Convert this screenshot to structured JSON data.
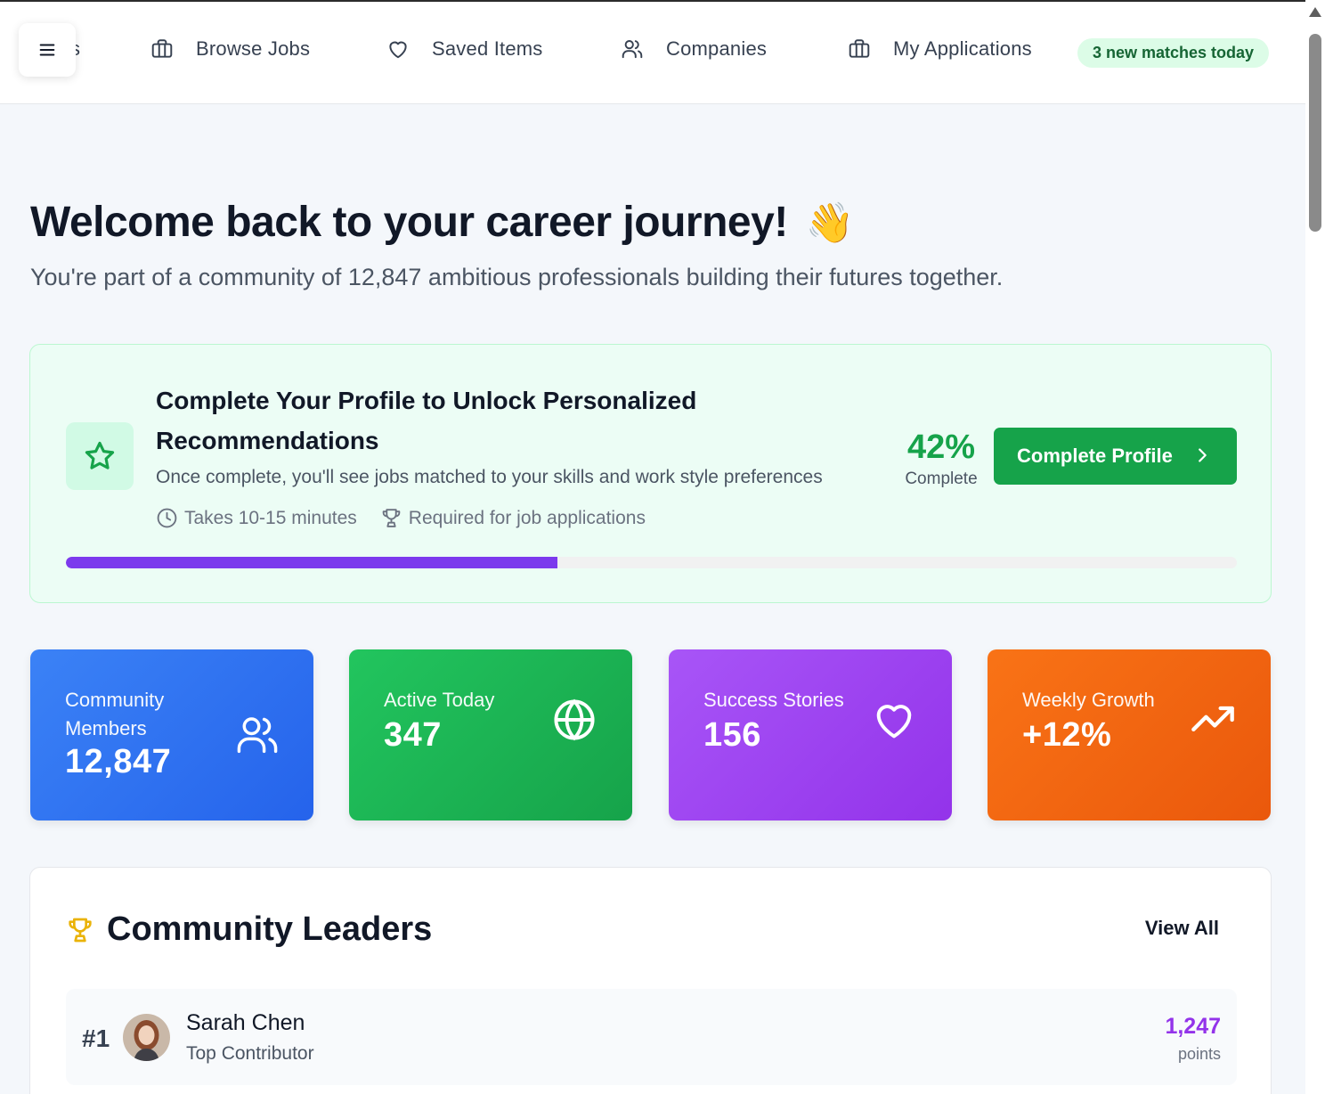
{
  "header": {
    "clipped_nav_fragment": "s",
    "nav": [
      {
        "label": "Browse Jobs",
        "icon": "briefcase-icon"
      },
      {
        "label": "Saved Items",
        "icon": "heart-icon"
      },
      {
        "label": "Companies",
        "icon": "users-icon"
      },
      {
        "label": "My Applications",
        "icon": "briefcase-icon"
      }
    ],
    "match_badge": "3 new matches today"
  },
  "welcome": {
    "title": "Welcome back to your career journey!",
    "emoji": "👋",
    "subtitle": "You're part of a community of 12,847 ambitious professionals building their futures together."
  },
  "profile": {
    "title": "Complete Your Profile to Unlock Personalized Recommendations",
    "description": "Once complete, you'll see jobs matched to your skills and work style preferences",
    "meta": [
      "Takes 10-15 minutes",
      "Required for job applications"
    ],
    "percent": "42%",
    "percent_label": "Complete",
    "progress": 0.42,
    "button": "Complete Profile"
  },
  "stats": [
    {
      "label": "Community Members",
      "value": "12,847",
      "icon": "users-icon"
    },
    {
      "label": "Active Today",
      "value": "347",
      "icon": "globe-icon"
    },
    {
      "label": "Success Stories",
      "value": "156",
      "icon": "heart-icon"
    },
    {
      "label": "Weekly Growth",
      "value": "+12%",
      "icon": "trending-up-icon"
    }
  ],
  "leaders": {
    "title": "Community Leaders",
    "view_all": "View All",
    "rows": [
      {
        "rank": "#1",
        "name": "Sarah Chen",
        "role": "Top Contributor",
        "points": "1,247",
        "points_label": "points"
      }
    ]
  },
  "colors": {
    "brand_green": "#16a34a",
    "progress_purple": "#7c3aed",
    "points_purple": "#9333ea"
  }
}
